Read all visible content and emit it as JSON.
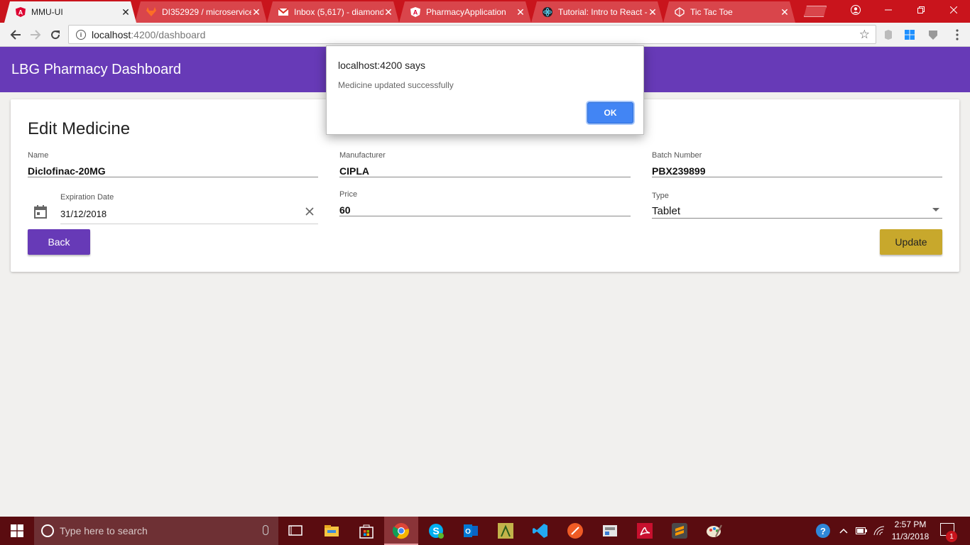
{
  "browser": {
    "tabs": [
      {
        "title": "MMU-UI",
        "icon": "angular-icon",
        "active": true
      },
      {
        "title": "DI352929 / microservice",
        "icon": "gitlab-icon",
        "active": false
      },
      {
        "title": "Inbox (5,617) - diamond",
        "icon": "gmail-icon",
        "active": false
      },
      {
        "title": "PharmacyApplication",
        "icon": "angular-icon",
        "active": false
      },
      {
        "title": "Tutorial: Intro to React -",
        "icon": "react-icon",
        "active": false
      },
      {
        "title": "Tic Tac Toe",
        "icon": "codepen-icon",
        "active": false
      }
    ],
    "url_host": "localhost",
    "url_path": ":4200/dashboard"
  },
  "app": {
    "title": "LBG Pharmacy Dashboard",
    "form_title": "Edit Medicine",
    "fields": {
      "name": {
        "label": "Name",
        "value": "Diclofinac-20MG"
      },
      "manufacturer": {
        "label": "Manufacturer",
        "value": "CIPLA"
      },
      "batch": {
        "label": "Batch Number",
        "value": "PBX239899"
      },
      "expiration": {
        "label": "Expiration Date",
        "value": "31/12/2018"
      },
      "price": {
        "label": "Price",
        "value": "60"
      },
      "type": {
        "label": "Type",
        "value": "Tablet"
      }
    },
    "back_label": "Back",
    "update_label": "Update",
    "colors": {
      "primary": "#673ab7",
      "accent": "#c8a82c"
    }
  },
  "dialog": {
    "title": "localhost:4200 says",
    "message": "Medicine updated successfully",
    "ok_label": "OK"
  },
  "taskbar": {
    "search_placeholder": "Type here to search",
    "time": "2:57 PM",
    "date": "11/3/2018",
    "notification_count": "1"
  }
}
